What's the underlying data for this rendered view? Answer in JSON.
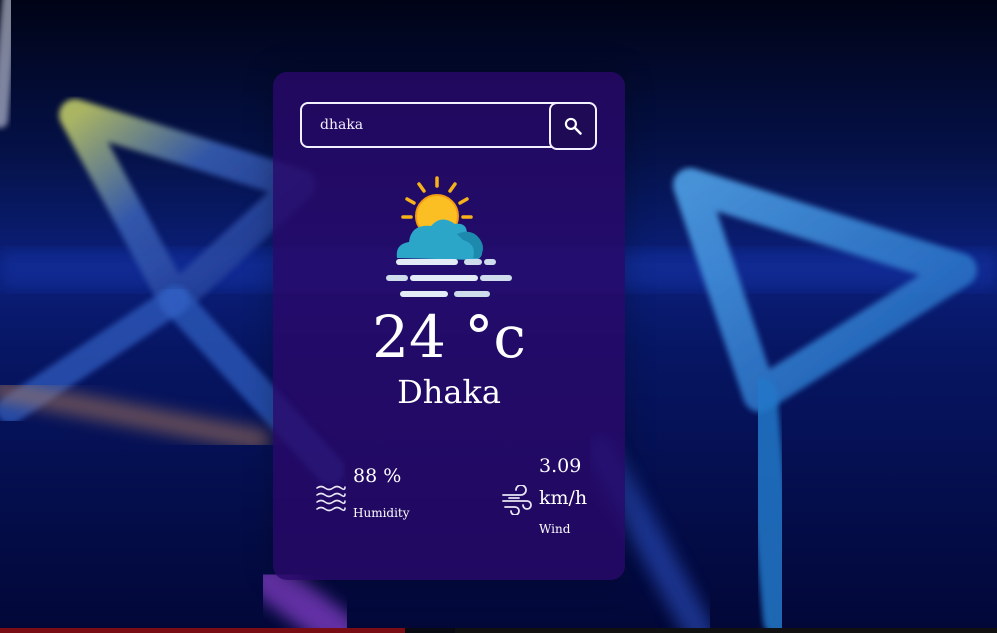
{
  "search": {
    "value": "dhaka",
    "button_icon": "search-icon"
  },
  "weather": {
    "icon": "sun-cloud-mist-icon",
    "temperature": "24 °c",
    "city": "Dhaka"
  },
  "details": {
    "humidity": {
      "icon": "waves-icon",
      "value": "88 %",
      "label": "Humidity"
    },
    "wind": {
      "icon": "wind-icon",
      "value": "3.09 km/h",
      "label": "Wind"
    }
  },
  "colors": {
    "card": "#28086a",
    "text": "#ffffff",
    "search_button": "#1f0b55",
    "sun": "#fbbf24",
    "cloud": "#2ba6c9"
  }
}
